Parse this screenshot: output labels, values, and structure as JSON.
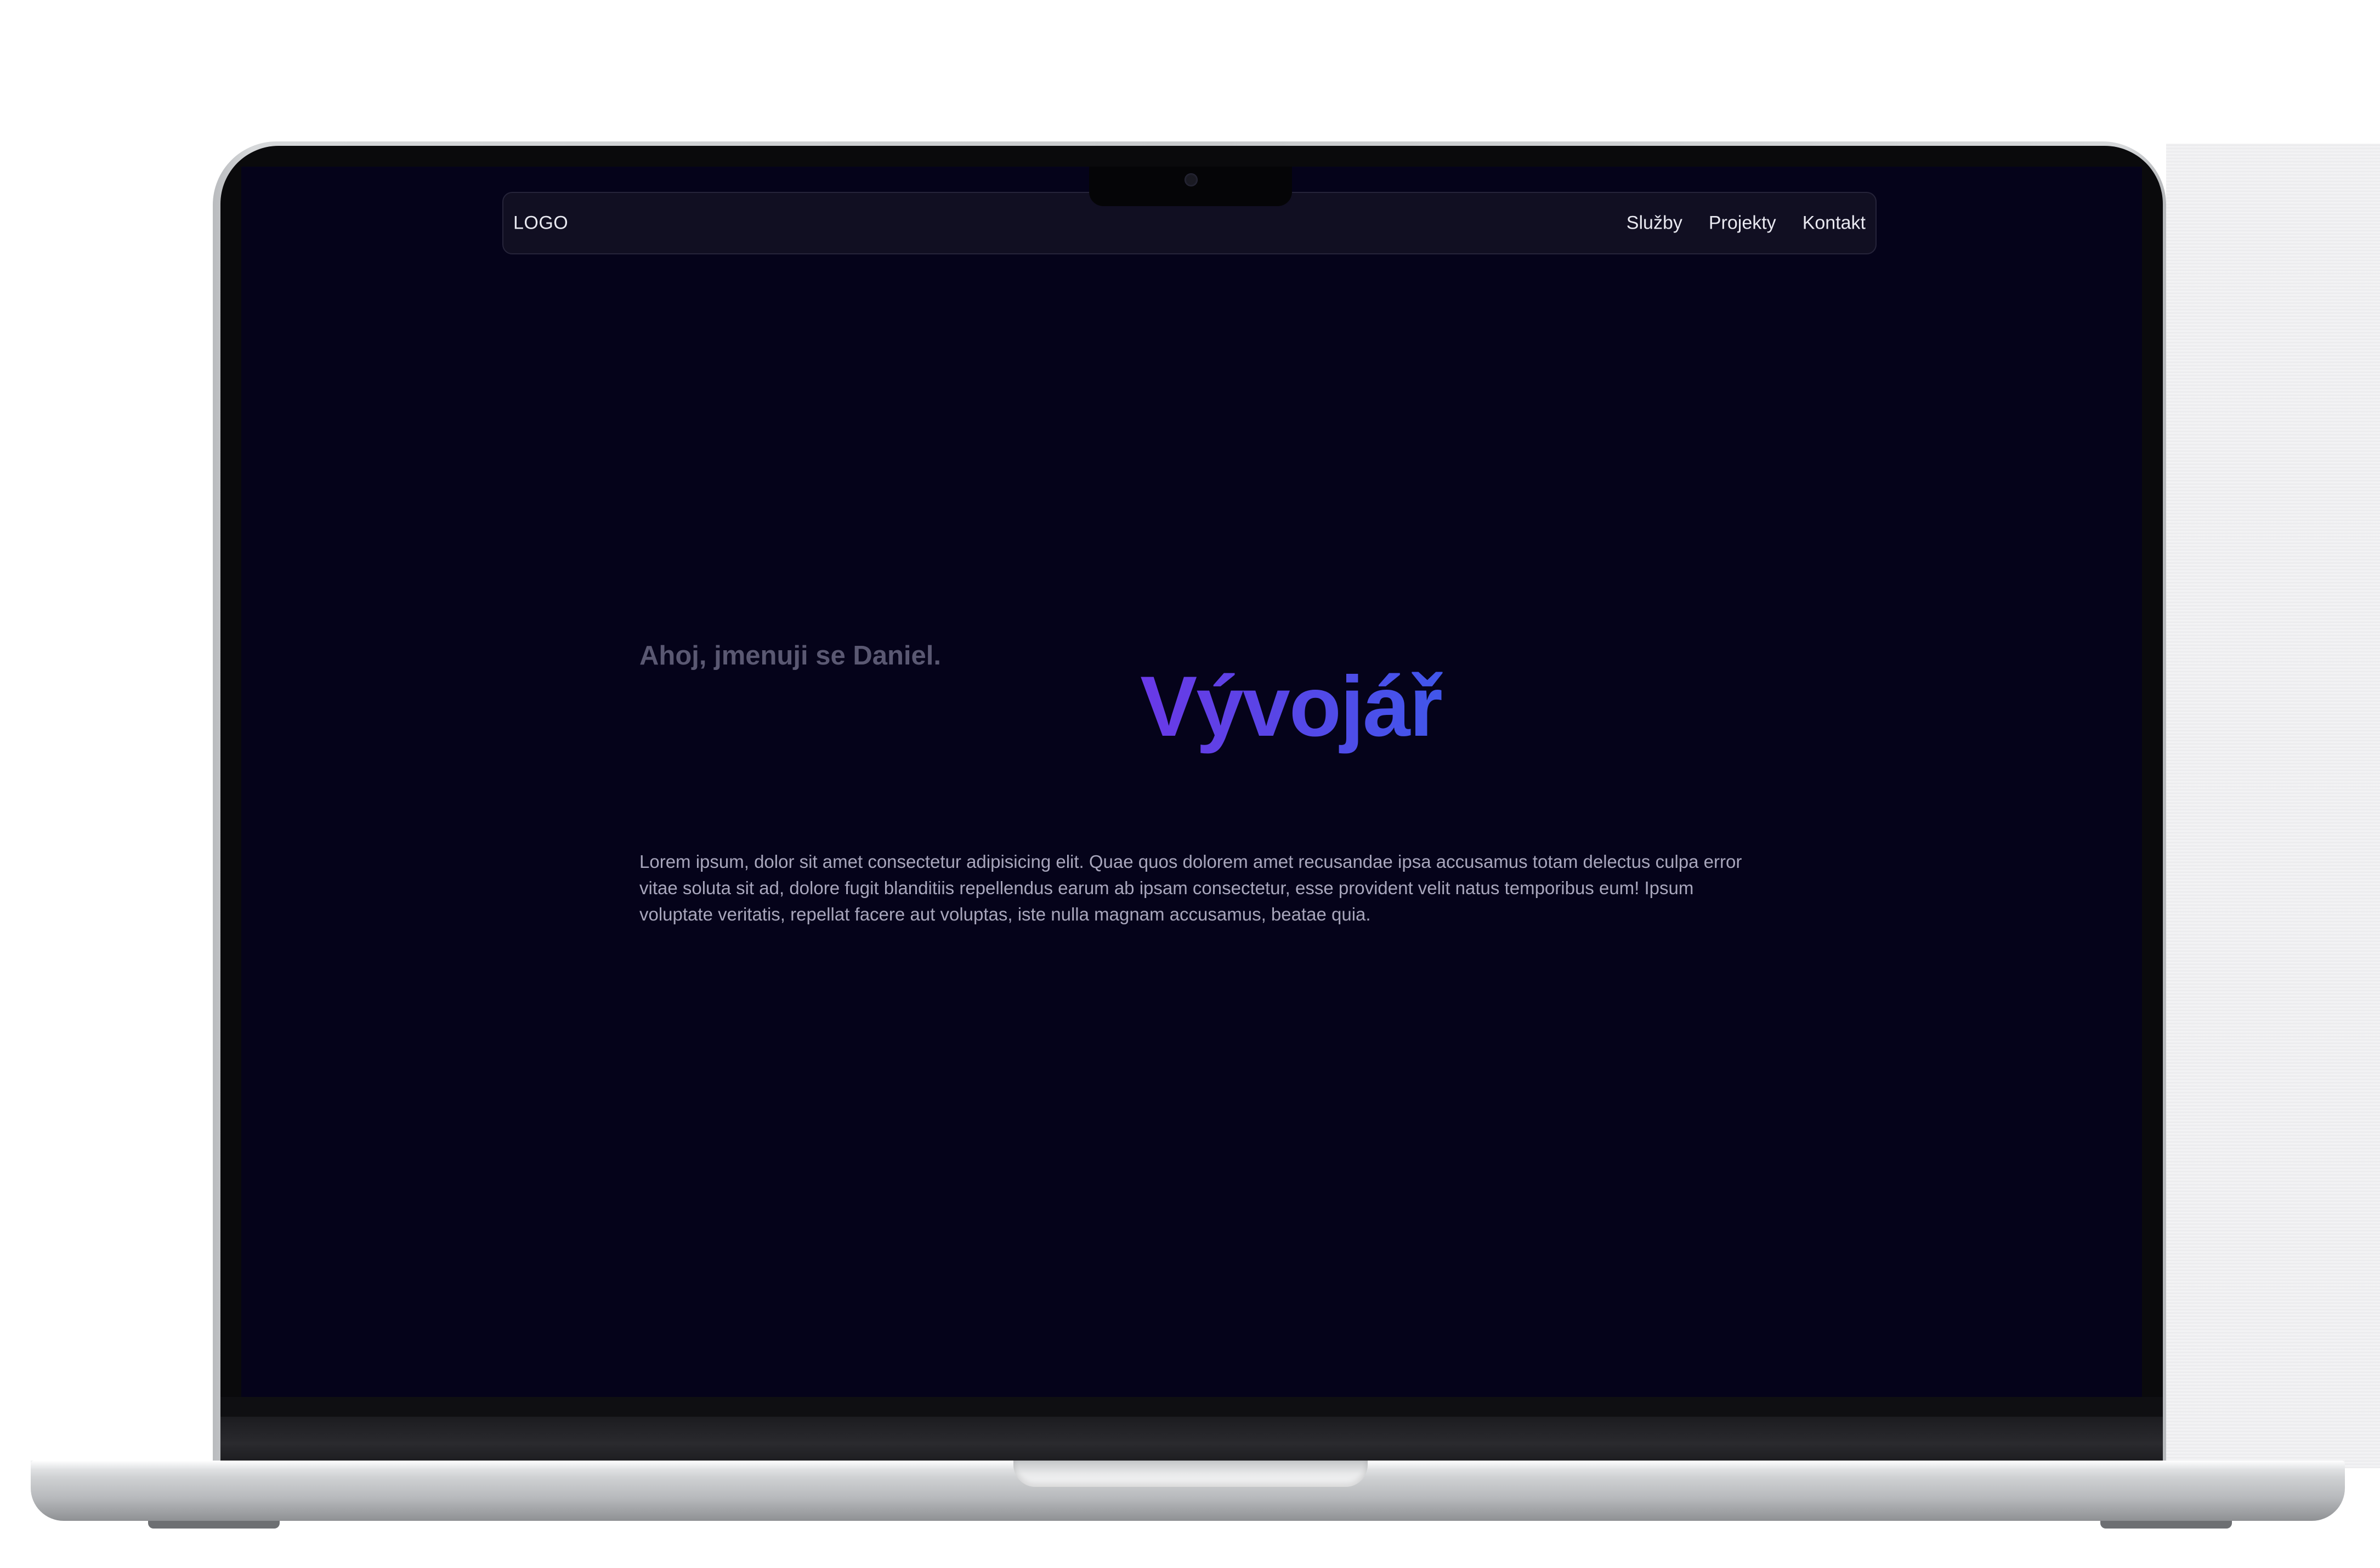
{
  "site": {
    "logo": "LOGO",
    "nav": [
      {
        "label": "Služby"
      },
      {
        "label": "Projekty"
      },
      {
        "label": "Kontakt"
      }
    ]
  },
  "hero": {
    "greeting": "Ahoj, jmenuji se Daniel.",
    "title": "Vývojář",
    "description": "Lorem ipsum, dolor sit amet consectetur adipisicing elit. Quae quos dolorem amet recusandae ipsa accusamus totam delectus culpa error vitae soluta sit ad, dolore fugit blanditiis repellendus earum ab ipsam consectetur, esse provident velit natus temporibus eum! Ipsum voluptate veritatis, repellat facere aut voluptas, iste nulla magnam accusamus, beatae quia."
  },
  "colors": {
    "background": "#05031a",
    "title_gradient_start": "#7a2ee8",
    "title_gradient_end": "#2f63ee",
    "greeting": "#5a5872",
    "body_text": "#a8a6bc"
  },
  "device": {
    "frame": "laptop-mockup",
    "icons": [
      "camera-icon"
    ]
  }
}
